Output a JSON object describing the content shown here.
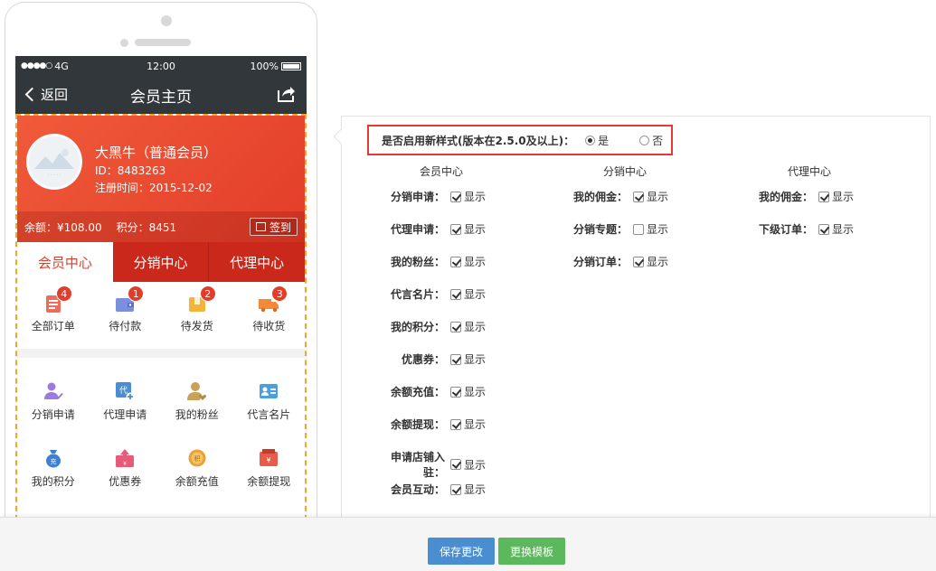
{
  "phone": {
    "status": {
      "signal": "●●●●○",
      "network": "4G",
      "time": "12:00",
      "battery": "100%"
    },
    "nav": {
      "back": "返回",
      "title": "会员主页",
      "share_icon": "share-icon"
    },
    "profile": {
      "name": "大黑牛（普通会员）",
      "id": "ID：8483263",
      "registered": "注册时间：2015-12-02",
      "balance": "余额：¥108.00",
      "points": "积分：8451",
      "signin": "签到"
    },
    "tabs": [
      "会员中心",
      "分销中心",
      "代理中心"
    ],
    "orders": [
      {
        "label": "全部订单",
        "badge": "4",
        "color": "#ef6b5a"
      },
      {
        "label": "待付款",
        "badge": "1",
        "color": "#7b8fe0"
      },
      {
        "label": "待发货",
        "badge": "2",
        "color": "#f2b53a"
      },
      {
        "label": "待收货",
        "badge": "3",
        "color": "#f28a3a"
      }
    ],
    "grid": [
      {
        "label": "分销申请",
        "icon": "user-check-icon",
        "color": "#9b7be0"
      },
      {
        "label": "代理申请",
        "icon": "proxy-icon",
        "color": "#4a8ed1"
      },
      {
        "label": "我的粉丝",
        "icon": "fans-icon",
        "color": "#c8a25a"
      },
      {
        "label": "代言名片",
        "icon": "card-icon",
        "color": "#4a9fe0"
      },
      {
        "label": "我的积分",
        "icon": "money-bag-icon",
        "color": "#3d7fd1"
      },
      {
        "label": "优惠券",
        "icon": "coupon-icon",
        "color": "#e85a7a"
      },
      {
        "label": "余额充值",
        "icon": "coin-icon",
        "color": "#e8a23a"
      },
      {
        "label": "余额提现",
        "icon": "withdraw-icon",
        "color": "#e85a4a"
      }
    ]
  },
  "settings": {
    "new_style_label": "是否启用新样式(版本在2.5.0及以上)：",
    "new_style_yes": "是",
    "new_style_no": "否",
    "columns": [
      {
        "title": "会员中心",
        "items": [
          {
            "label": "分销申请：",
            "checked": true
          },
          {
            "label": "代理申请：",
            "checked": true
          },
          {
            "label": "我的粉丝：",
            "checked": true
          },
          {
            "label": "代言名片：",
            "checked": true
          },
          {
            "label": "我的积分：",
            "checked": true
          },
          {
            "label": "优惠券：",
            "checked": true
          },
          {
            "label": "余额充值：",
            "checked": true
          },
          {
            "label": "余额提现：",
            "checked": true
          },
          {
            "label": "申请店铺入驻：",
            "checked": true
          },
          {
            "label": "会员互动：",
            "checked": true
          }
        ]
      },
      {
        "title": "分销中心",
        "items": [
          {
            "label": "我的佣金：",
            "checked": true
          },
          {
            "label": "分销专题：",
            "checked": false
          },
          {
            "label": "分销订单：",
            "checked": true
          }
        ]
      },
      {
        "title": "代理中心",
        "items": [
          {
            "label": "我的佣金：",
            "checked": true
          },
          {
            "label": "下级订单：",
            "checked": true
          }
        ]
      }
    ],
    "show_text": "显示"
  },
  "footer": {
    "save": "保存更改",
    "change_template": "更换模板"
  }
}
